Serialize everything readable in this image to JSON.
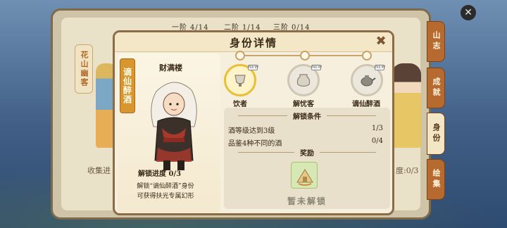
{
  "tiers": [
    {
      "label": "一阶",
      "value": "4/14"
    },
    {
      "label": "二阶",
      "value": "1/14"
    },
    {
      "label": "三阶",
      "value": "0/14"
    }
  ],
  "background": {
    "left_tab": "花山幽客",
    "collect_left": "收集进",
    "collect_right": "度:0/3"
  },
  "side_tabs": [
    "山志",
    "成就",
    "身份",
    "绘集"
  ],
  "panel": {
    "title": "身份详情",
    "vertical_tag": "谪仙醉酒",
    "character_name": "财满楼",
    "unlock_progress": "解锁进度 0/3",
    "unlock_desc_line1": "解锁“谪仙醉酒”身份",
    "unlock_desc_line2": "可获得扶光专属幻形",
    "badges": [
      {
        "label": "饮者",
        "tag": "NEW",
        "icon": "cup-icon",
        "active": true
      },
      {
        "label": "解忧客",
        "tag": "NEW",
        "icon": "jar-icon",
        "active": false
      },
      {
        "label": "谪仙醉酒",
        "tag": "NEW",
        "icon": "teapot-icon",
        "active": false
      }
    ],
    "conditions_header": "解锁条件",
    "conditions": [
      {
        "text": "酒等级达到3级",
        "value": "1/3"
      },
      {
        "text": "品鉴4种不同的酒",
        "value": "0/4"
      }
    ],
    "reward_header": "奖励",
    "reward_icon": "tent-icon",
    "locked_label": "暂未解锁"
  },
  "colors": {
    "panel_border": "#8b6c45",
    "accent_orange": "#d9962f",
    "active_badge": "#e8bf35",
    "side_tab": "#b66a2f"
  }
}
